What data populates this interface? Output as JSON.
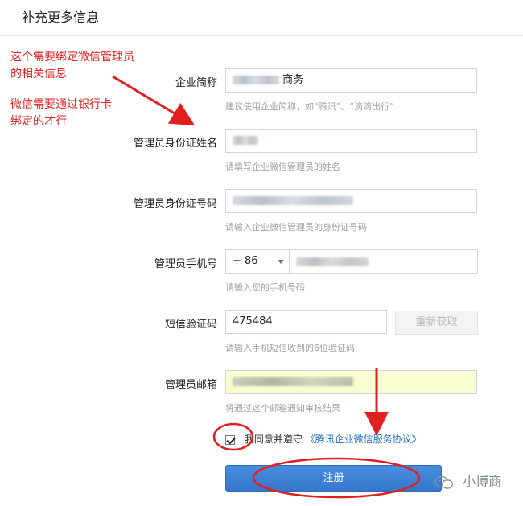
{
  "header": {
    "title": "补充更多信息"
  },
  "annotations": {
    "note1_line1": "这个需要绑定微信管理员",
    "note1_line2": "的相关信息",
    "note2_line1": "微信需要通过银行卡",
    "note2_line2": "绑定的才行"
  },
  "form": {
    "company_label": "企业简称",
    "company_value_suffix": "商务",
    "company_hint": "建议使用企业简称，如“腾讯”、“滴滴出行”",
    "admin_name_label": "管理员身份证姓名",
    "admin_name_hint": "请填写企业微信管理员的姓名",
    "admin_id_label": "管理员身份证号码",
    "admin_id_hint": "请输入企业微信管理员的身份证号码",
    "phone_label": "管理员手机号",
    "country_code": "+ 86",
    "phone_hint": "请输入您的手机号码",
    "sms_label": "短信验证码",
    "sms_value": "475484",
    "resend_label": "重新获取",
    "sms_hint": "请输入手机短信收到的6位验证码",
    "email_label": "管理员邮箱",
    "email_hint": "将通过这个邮箱通知审核结果",
    "agree_text": "我同意并遵守",
    "agree_link": "《腾讯企业微信服务协议》",
    "agree_checked": true,
    "register_label": "注册"
  },
  "watermark": {
    "text": "小博商"
  },
  "colors": {
    "annotation_red": "#e02020",
    "primary_blue": "#3a7fd5",
    "email_field_bg": "#fafdd2",
    "link_blue": "#2a6fbf"
  }
}
